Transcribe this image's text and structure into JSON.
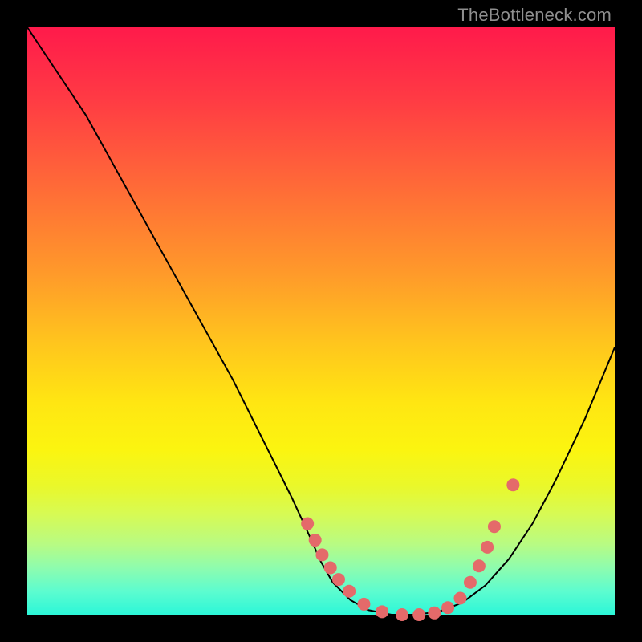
{
  "watermark": {
    "text": "TheBottleneck.com"
  },
  "chart_data": {
    "type": "line",
    "title": "",
    "xlabel": "",
    "ylabel": "",
    "xlim": [
      0,
      1
    ],
    "ylim": [
      0,
      1
    ],
    "note": "No axis ticks or labels shown. x/y are fractional positions within the plot area; y=1 is top, y=0 is bottom.",
    "series": [
      {
        "name": "curve",
        "x": [
          0.0,
          0.05,
          0.1,
          0.15,
          0.2,
          0.25,
          0.3,
          0.35,
          0.4,
          0.45,
          0.48,
          0.5,
          0.52,
          0.55,
          0.58,
          0.62,
          0.66,
          0.7,
          0.74,
          0.78,
          0.82,
          0.86,
          0.9,
          0.95,
          1.0
        ],
        "y": [
          1.0,
          0.925,
          0.85,
          0.76,
          0.67,
          0.58,
          0.49,
          0.4,
          0.3,
          0.2,
          0.135,
          0.09,
          0.055,
          0.025,
          0.008,
          0.0,
          0.0,
          0.005,
          0.02,
          0.05,
          0.095,
          0.155,
          0.23,
          0.335,
          0.455
        ],
        "stroke": "#000000",
        "stroke_width": 2
      }
    ],
    "markers": [
      {
        "name": "dots",
        "fill": "#e46a6a",
        "radius": 8,
        "x": [
          0.477,
          0.49,
          0.502,
          0.516,
          0.53,
          0.548,
          0.573,
          0.604,
          0.638,
          0.667,
          0.693,
          0.716,
          0.737,
          0.754,
          0.769,
          0.783,
          0.795,
          0.827
        ],
        "y": [
          0.155,
          0.127,
          0.102,
          0.08,
          0.06,
          0.04,
          0.018,
          0.005,
          0.0,
          0.0,
          0.003,
          0.012,
          0.028,
          0.055,
          0.083,
          0.115,
          0.15,
          0.221
        ]
      }
    ]
  }
}
